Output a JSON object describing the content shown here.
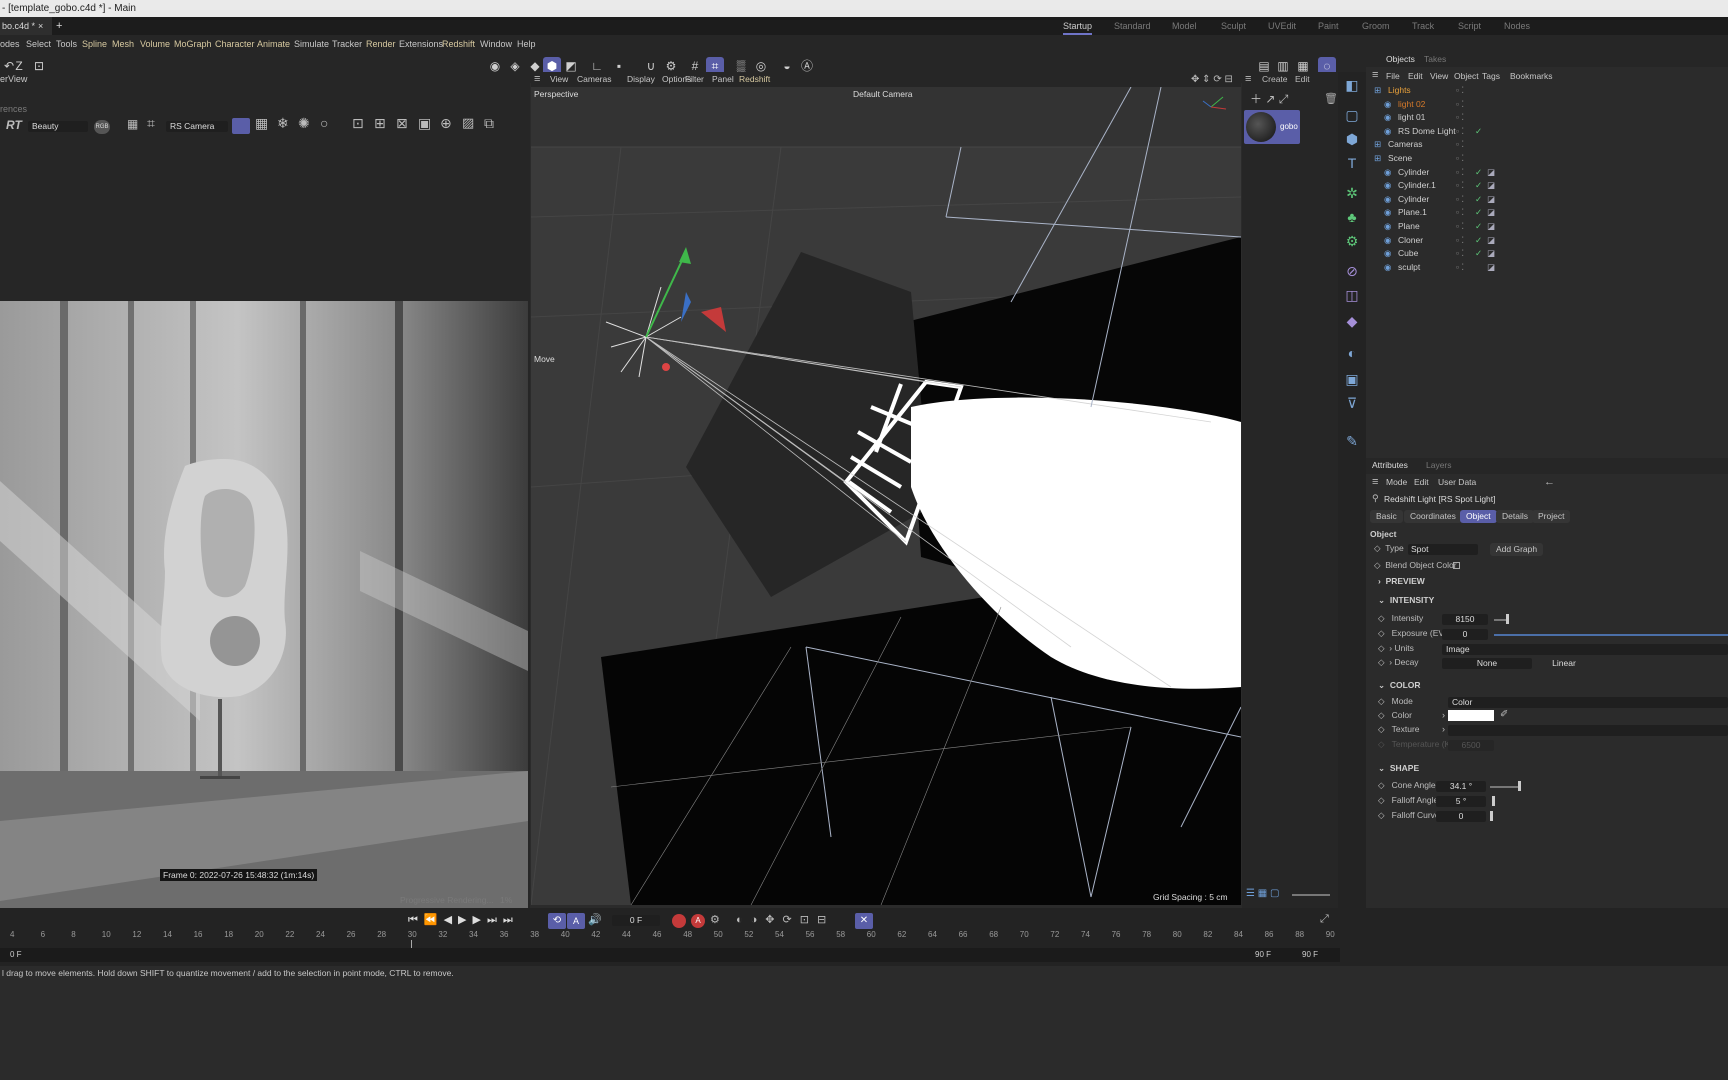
{
  "window": {
    "title": "- [template_gobo.c4d *] - Main"
  },
  "tabs": {
    "doc_tab": "bo.c4d *",
    "close": "×",
    "add": "+"
  },
  "layouts": [
    "Startup",
    "Standard",
    "Model",
    "Sculpt",
    "UVEdit",
    "Paint",
    "Groom",
    "Track",
    "Script",
    "Nodes"
  ],
  "menus": [
    "odes",
    "Select",
    "Tools",
    "Spline",
    "Mesh",
    "Volume",
    "MoGraph",
    "Character",
    "Animate",
    "Simulate",
    "Tracker",
    "Render",
    "Extensions",
    "Redshift",
    "Window",
    "Help"
  ],
  "renderview": {
    "title": "erView",
    "prefs": "rences",
    "rt": "RT",
    "aov": "Beauty",
    "channel": "RGB",
    "camera": "RS Camera",
    "frame_info": "Frame  0:  2022-07-26  15:48:32  (1m:14s)",
    "progress": "Progressive Rendering...",
    "progress_pct": "1%"
  },
  "viewport": {
    "menu": [
      "View",
      "Cameras",
      "Display",
      "Options",
      "Filter",
      "Panel",
      "Redshift"
    ],
    "projection": "Perspective",
    "camera": "Default Camera",
    "tool": "Move",
    "grid_spacing": "Grid Spacing : 5 cm"
  },
  "materials": {
    "create": "Create",
    "edit": "Edit",
    "material_name": "gobo"
  },
  "objects": {
    "tabs": [
      "Objects",
      "Takes"
    ],
    "menu": [
      "File",
      "Edit",
      "View",
      "Object",
      "Tags",
      "Bookmarks"
    ],
    "tree": [
      {
        "name": "Lights",
        "indent": 0,
        "color": "#e9a13b"
      },
      {
        "name": "light 02",
        "indent": 1,
        "color": "#d67a2a"
      },
      {
        "name": "light 01",
        "indent": 1,
        "color": "#cfcfcf"
      },
      {
        "name": "RS Dome Light",
        "indent": 1,
        "color": "#cfcfcf"
      },
      {
        "name": "Cameras",
        "indent": 0,
        "color": "#cfcfcf"
      },
      {
        "name": "Scene",
        "indent": 0,
        "color": "#cfcfcf"
      },
      {
        "name": "Cylinder",
        "indent": 1,
        "color": "#cfcfcf"
      },
      {
        "name": "Cylinder.1",
        "indent": 1,
        "color": "#cfcfcf"
      },
      {
        "name": "Cylinder",
        "indent": 1,
        "color": "#cfcfcf"
      },
      {
        "name": "Plane.1",
        "indent": 1,
        "color": "#cfcfcf"
      },
      {
        "name": "Plane",
        "indent": 1,
        "color": "#cfcfcf"
      },
      {
        "name": "Cloner",
        "indent": 1,
        "color": "#cfcfcf"
      },
      {
        "name": "Cube",
        "indent": 1,
        "color": "#cfcfcf"
      },
      {
        "name": "sculpt",
        "indent": 1,
        "color": "#cfcfcf"
      }
    ]
  },
  "attributes": {
    "tabs": [
      "Attributes",
      "Layers"
    ],
    "menu": [
      "Mode",
      "Edit",
      "User Data"
    ],
    "object_title": "Redshift Light [RS Spot Light]",
    "subtabs": [
      "Basic",
      "Coordinates",
      "Object",
      "Details",
      "Project"
    ],
    "section_object": "Object",
    "type_label": "Type",
    "type_value": "Spot",
    "add_graph": "Add Graph",
    "blend_label": "Blend Object Color",
    "preview": "PREVIEW",
    "intensity_section": "INTENSITY",
    "intensity_label": "Intensity",
    "intensity_value": "8150",
    "exposure_label": "Exposure (EV)",
    "exposure_value": "0",
    "units_label": "Units",
    "units_value": "Image",
    "decay_label": "Decay",
    "decay_value": "None",
    "decay_value2": "Linear",
    "color_section": "COLOR",
    "mode_label": "Mode",
    "mode_value": "Color",
    "color_label": "Color",
    "texture_label": "Texture",
    "temp_label": "Temperature (K)",
    "temp_value": "6500",
    "shape_section": "SHAPE",
    "cone_label": "Cone Angle",
    "cone_value": "34.1 °",
    "falloff_label": "Falloff Angle",
    "falloff_value": "5 °",
    "curve_label": "Falloff Curve",
    "curve_value": "0"
  },
  "timeline": {
    "current_frame": "0 F",
    "start": "0 F",
    "end": "90 F",
    "end2": "90 F",
    "ticks": [
      "4",
      "6",
      "8",
      "10",
      "12",
      "14",
      "16",
      "18",
      "20",
      "22",
      "24",
      "26",
      "28",
      "30",
      "32",
      "34",
      "36",
      "38",
      "40",
      "42",
      "44",
      "46",
      "48",
      "50",
      "52",
      "54",
      "56",
      "58",
      "60",
      "62",
      "64",
      "66",
      "68",
      "70",
      "72",
      "74",
      "76",
      "78",
      "80",
      "82",
      "84",
      "86",
      "88",
      "90"
    ]
  },
  "status": "l drag to move elements. Hold down SHIFT to quantize movement / add to the selection in point mode, CTRL to remove."
}
